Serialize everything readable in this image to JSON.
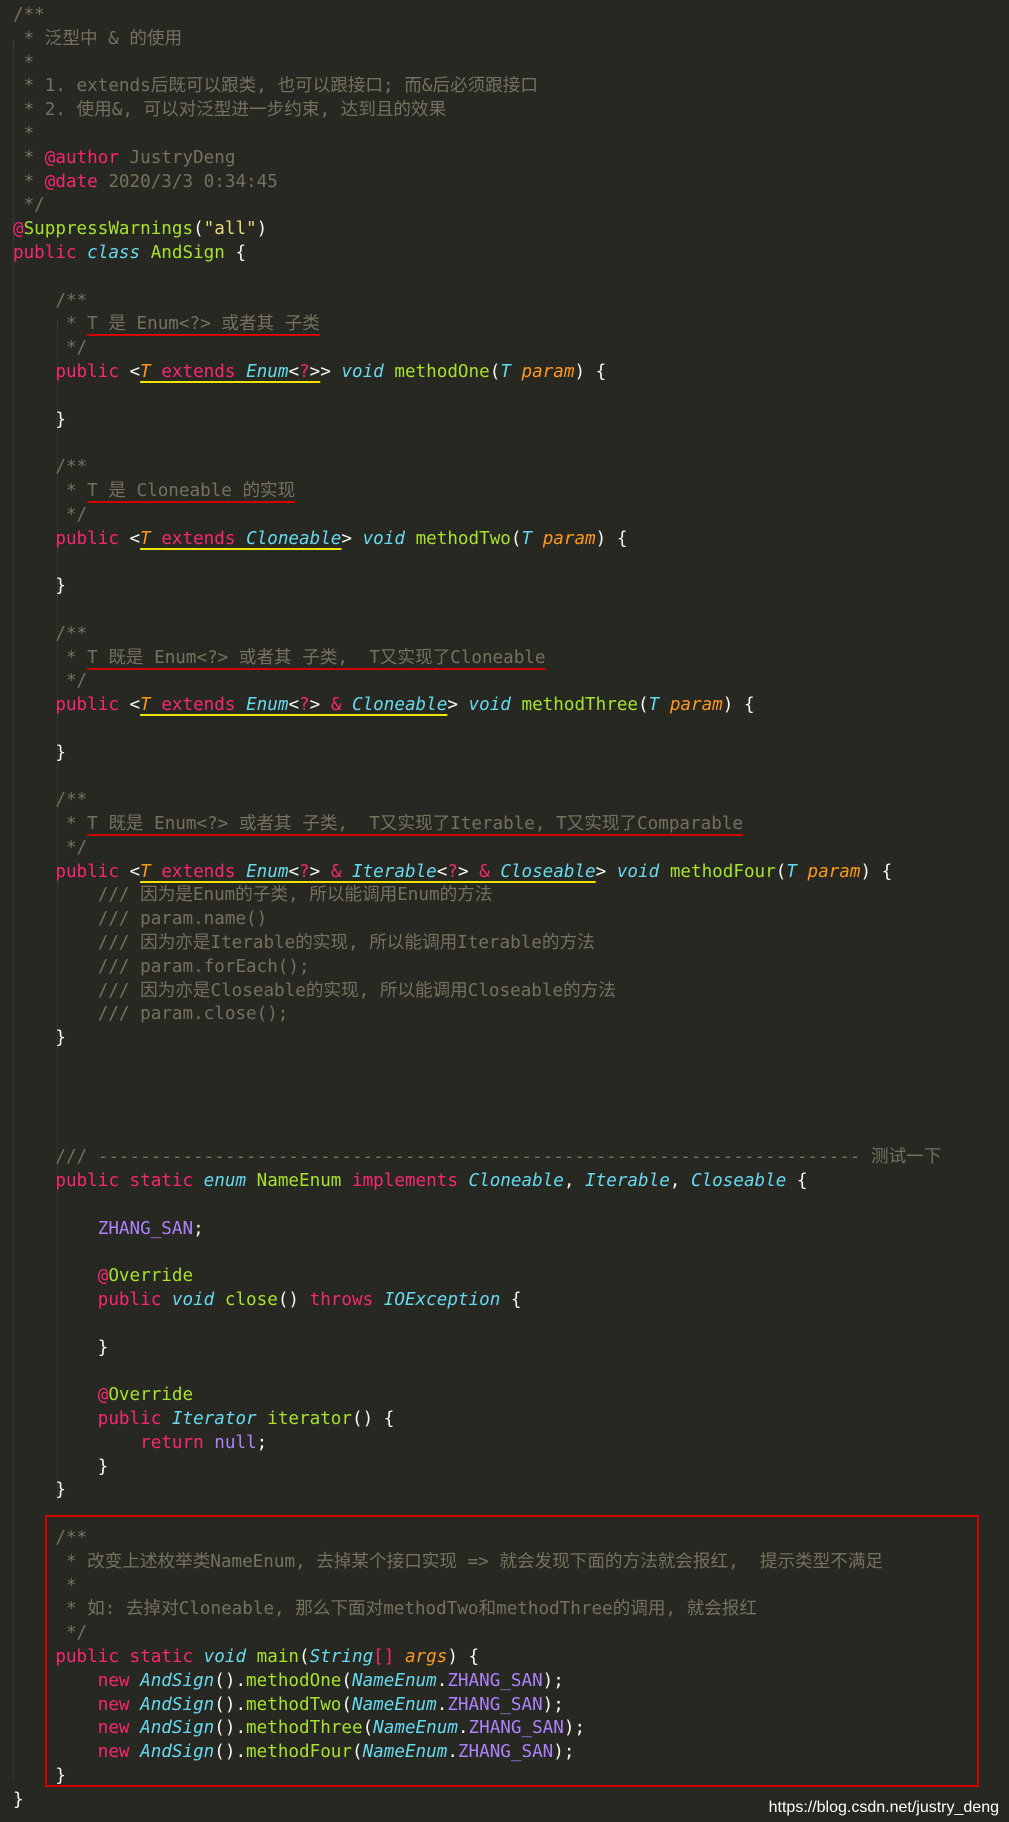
{
  "lines": [
    [
      {
        "c": "c",
        "t": "/**"
      }
    ],
    [
      {
        "c": "c",
        "t": " * 泛型中 & 的使用"
      }
    ],
    [
      {
        "c": "c",
        "t": " *"
      }
    ],
    [
      {
        "c": "c",
        "t": " * 1. extends后既可以跟类, 也可以跟接口; 而&后必须跟接口"
      }
    ],
    [
      {
        "c": "c",
        "t": " * 2. 使用&, 可以对泛型进一步约束, 达到且的效果"
      }
    ],
    [
      {
        "c": "c",
        "t": " *"
      }
    ],
    [
      {
        "c": "c",
        "t": " * "
      },
      {
        "c": "k",
        "t": "@author"
      },
      {
        "c": "c",
        "t": " JustryDeng"
      }
    ],
    [
      {
        "c": "c",
        "t": " * "
      },
      {
        "c": "k",
        "t": "@date"
      },
      {
        "c": "c",
        "t": " 2020/3/3 0:34:45"
      }
    ],
    [
      {
        "c": "c",
        "t": " */"
      }
    ],
    [
      {
        "c": "k",
        "t": "@"
      },
      {
        "c": "f",
        "t": "SuppressWarnings"
      },
      {
        "c": "",
        "t": "("
      },
      {
        "c": "s",
        "t": "\"all\""
      },
      {
        "c": "",
        "t": ")"
      }
    ],
    [
      {
        "c": "k",
        "t": "public "
      },
      {
        "c": "t",
        "t": "class "
      },
      {
        "c": "f",
        "t": "AndSign"
      },
      {
        "c": "",
        "t": " {"
      }
    ],
    [
      {
        "c": "",
        "t": ""
      }
    ],
    [
      {
        "c": "c",
        "t": "    /**"
      }
    ],
    [
      {
        "c": "c",
        "t": "     * "
      },
      {
        "c": "c red-ul",
        "t": "T 是 Enum<?> 或者其 子类"
      }
    ],
    [
      {
        "c": "c",
        "t": "     */"
      }
    ],
    [
      {
        "c": "k",
        "t": "    public "
      },
      {
        "c": "",
        "t": "<"
      },
      {
        "c": "p ul",
        "t": "T "
      },
      {
        "c": "k ul",
        "t": "extends "
      },
      {
        "c": "t ul",
        "t": "Enum"
      },
      {
        "c": "ul",
        "t": "<"
      },
      {
        "c": "k ul",
        "t": "?"
      },
      {
        "c": "ul",
        "t": ">"
      },
      {
        "c": "",
        "t": "> "
      },
      {
        "c": "t",
        "t": "void "
      },
      {
        "c": "f",
        "t": "methodOne"
      },
      {
        "c": "",
        "t": "("
      },
      {
        "c": "t",
        "t": "T "
      },
      {
        "c": "p",
        "t": "param"
      },
      {
        "c": "",
        "t": ") {"
      }
    ],
    [
      {
        "c": "",
        "t": ""
      }
    ],
    [
      {
        "c": "",
        "t": "    }"
      }
    ],
    [
      {
        "c": "",
        "t": ""
      }
    ],
    [
      {
        "c": "c",
        "t": "    /**"
      }
    ],
    [
      {
        "c": "c",
        "t": "     * "
      },
      {
        "c": "c red-ul",
        "t": "T 是 Cloneable 的实现"
      }
    ],
    [
      {
        "c": "c",
        "t": "     */"
      }
    ],
    [
      {
        "c": "k",
        "t": "    public "
      },
      {
        "c": "",
        "t": "<"
      },
      {
        "c": "p ul",
        "t": "T "
      },
      {
        "c": "k ul",
        "t": "extends "
      },
      {
        "c": "t ul",
        "t": "Cloneable"
      },
      {
        "c": "",
        "t": "> "
      },
      {
        "c": "t",
        "t": "void "
      },
      {
        "c": "f",
        "t": "methodTwo"
      },
      {
        "c": "",
        "t": "("
      },
      {
        "c": "t",
        "t": "T "
      },
      {
        "c": "p",
        "t": "param"
      },
      {
        "c": "",
        "t": ") {"
      }
    ],
    [
      {
        "c": "",
        "t": ""
      }
    ],
    [
      {
        "c": "",
        "t": "    }"
      }
    ],
    [
      {
        "c": "",
        "t": ""
      }
    ],
    [
      {
        "c": "c",
        "t": "    /**"
      }
    ],
    [
      {
        "c": "c",
        "t": "     * "
      },
      {
        "c": "c red-ul",
        "t": "T 既是 Enum<?> 或者其 子类,  T又实现了Cloneable"
      }
    ],
    [
      {
        "c": "c",
        "t": "     */"
      }
    ],
    [
      {
        "c": "k",
        "t": "    public "
      },
      {
        "c": "",
        "t": "<"
      },
      {
        "c": "p ul",
        "t": "T "
      },
      {
        "c": "k ul",
        "t": "extends "
      },
      {
        "c": "t ul",
        "t": "Enum"
      },
      {
        "c": "ul",
        "t": "<"
      },
      {
        "c": "k ul",
        "t": "?"
      },
      {
        "c": "ul",
        "t": "> "
      },
      {
        "c": "k ul",
        "t": "& "
      },
      {
        "c": "t ul",
        "t": "Cloneable"
      },
      {
        "c": "",
        "t": "> "
      },
      {
        "c": "t",
        "t": "void "
      },
      {
        "c": "f",
        "t": "methodThree"
      },
      {
        "c": "",
        "t": "("
      },
      {
        "c": "t",
        "t": "T "
      },
      {
        "c": "p",
        "t": "param"
      },
      {
        "c": "",
        "t": ") {"
      }
    ],
    [
      {
        "c": "",
        "t": ""
      }
    ],
    [
      {
        "c": "",
        "t": "    }"
      }
    ],
    [
      {
        "c": "",
        "t": ""
      }
    ],
    [
      {
        "c": "c",
        "t": "    /**"
      }
    ],
    [
      {
        "c": "c",
        "t": "     * "
      },
      {
        "c": "c red-ul",
        "t": "T 既是 Enum<?> 或者其 子类,  T又实现了Iterable, T又实现了Comparable"
      }
    ],
    [
      {
        "c": "c",
        "t": "     */"
      }
    ],
    [
      {
        "c": "k",
        "t": "    public "
      },
      {
        "c": "",
        "t": "<"
      },
      {
        "c": "p ul",
        "t": "T "
      },
      {
        "c": "k ul",
        "t": "extends "
      },
      {
        "c": "t ul",
        "t": "Enum"
      },
      {
        "c": "ul",
        "t": "<"
      },
      {
        "c": "k ul",
        "t": "?"
      },
      {
        "c": "ul",
        "t": "> "
      },
      {
        "c": "k ul",
        "t": "& "
      },
      {
        "c": "t ul",
        "t": "Iterable"
      },
      {
        "c": "ul",
        "t": "<"
      },
      {
        "c": "k ul",
        "t": "?"
      },
      {
        "c": "ul",
        "t": "> "
      },
      {
        "c": "k ul",
        "t": "& "
      },
      {
        "c": "t ul",
        "t": "Closeable"
      },
      {
        "c": "",
        "t": "> "
      },
      {
        "c": "t",
        "t": "void "
      },
      {
        "c": "f",
        "t": "methodFour"
      },
      {
        "c": "",
        "t": "("
      },
      {
        "c": "t",
        "t": "T "
      },
      {
        "c": "p",
        "t": "param"
      },
      {
        "c": "",
        "t": ") {"
      }
    ],
    [
      {
        "c": "c",
        "t": "        /// 因为是Enum的子类, 所以能调用Enum的方法"
      }
    ],
    [
      {
        "c": "c",
        "t": "        /// param.name()"
      }
    ],
    [
      {
        "c": "c",
        "t": "        /// 因为亦是Iterable的实现, 所以能调用Iterable的方法"
      }
    ],
    [
      {
        "c": "c",
        "t": "        /// param.forEach();"
      }
    ],
    [
      {
        "c": "c",
        "t": "        /// 因为亦是Closeable的实现, 所以能调用Closeable的方法"
      }
    ],
    [
      {
        "c": "c",
        "t": "        /// param.close();"
      }
    ],
    [
      {
        "c": "",
        "t": "    }"
      }
    ],
    [
      {
        "c": "",
        "t": ""
      }
    ],
    [
      {
        "c": "",
        "t": ""
      }
    ],
    [
      {
        "c": "",
        "t": ""
      }
    ],
    [
      {
        "c": "",
        "t": ""
      }
    ],
    [
      {
        "c": "c",
        "t": "    /// ------------------------------------------------------------------------ 测试一下"
      }
    ],
    [
      {
        "c": "k",
        "t": "    public static "
      },
      {
        "c": "t",
        "t": "enum "
      },
      {
        "c": "f",
        "t": "NameEnum "
      },
      {
        "c": "k",
        "t": "implements "
      },
      {
        "c": "t",
        "t": "Cloneable"
      },
      {
        "c": "",
        "t": ", "
      },
      {
        "c": "t",
        "t": "Iterable"
      },
      {
        "c": "",
        "t": ", "
      },
      {
        "c": "t",
        "t": "Closeable"
      },
      {
        "c": "",
        "t": " {"
      }
    ],
    [
      {
        "c": "",
        "t": ""
      }
    ],
    [
      {
        "c": "cst",
        "t": "        ZHANG_SAN"
      },
      {
        "c": "",
        "t": ";"
      }
    ],
    [
      {
        "c": "",
        "t": ""
      }
    ],
    [
      {
        "c": "k",
        "t": "        @"
      },
      {
        "c": "f",
        "t": "Override"
      }
    ],
    [
      {
        "c": "k",
        "t": "        public "
      },
      {
        "c": "t",
        "t": "void "
      },
      {
        "c": "f",
        "t": "close"
      },
      {
        "c": "",
        "t": "() "
      },
      {
        "c": "k",
        "t": "throws "
      },
      {
        "c": "t",
        "t": "IOException"
      },
      {
        "c": "",
        "t": " {"
      }
    ],
    [
      {
        "c": "",
        "t": ""
      }
    ],
    [
      {
        "c": "",
        "t": "        }"
      }
    ],
    [
      {
        "c": "",
        "t": ""
      }
    ],
    [
      {
        "c": "k",
        "t": "        @"
      },
      {
        "c": "f",
        "t": "Override"
      }
    ],
    [
      {
        "c": "k",
        "t": "        public "
      },
      {
        "c": "t",
        "t": "Iterator "
      },
      {
        "c": "f",
        "t": "iterator"
      },
      {
        "c": "",
        "t": "() {"
      }
    ],
    [
      {
        "c": "k",
        "t": "            return "
      },
      {
        "c": "cst",
        "t": "null"
      },
      {
        "c": "",
        "t": ";"
      }
    ],
    [
      {
        "c": "",
        "t": "        }"
      }
    ],
    [
      {
        "c": "",
        "t": "    }"
      }
    ],
    [
      {
        "c": "",
        "t": ""
      }
    ],
    [
      {
        "c": "c",
        "t": "    /**"
      }
    ],
    [
      {
        "c": "c",
        "t": "     * 改变上述枚举类NameEnum, 去掉某个接口实现 => 就会发现下面的方法就会报红,  提示类型不满足"
      }
    ],
    [
      {
        "c": "c",
        "t": "     *"
      }
    ],
    [
      {
        "c": "c",
        "t": "     * 如: 去掉对Cloneable, 那么下面对methodTwo和methodThree的调用, 就会报红"
      }
    ],
    [
      {
        "c": "c",
        "t": "     */"
      }
    ],
    [
      {
        "c": "k",
        "t": "    public static "
      },
      {
        "c": "t",
        "t": "void "
      },
      {
        "c": "f",
        "t": "main"
      },
      {
        "c": "",
        "t": "("
      },
      {
        "c": "t",
        "t": "String"
      },
      {
        "c": "k",
        "t": "[] "
      },
      {
        "c": "p",
        "t": "args"
      },
      {
        "c": "",
        "t": ") {"
      }
    ],
    [
      {
        "c": "k",
        "t": "        new "
      },
      {
        "c": "t",
        "t": "AndSign"
      },
      {
        "c": "",
        "t": "()."
      },
      {
        "c": "f",
        "t": "methodOne"
      },
      {
        "c": "",
        "t": "("
      },
      {
        "c": "t",
        "t": "NameEnum"
      },
      {
        "c": "",
        "t": "."
      },
      {
        "c": "cst",
        "t": "ZHANG_SAN"
      },
      {
        "c": "",
        "t": ");"
      }
    ],
    [
      {
        "c": "k",
        "t": "        new "
      },
      {
        "c": "t",
        "t": "AndSign"
      },
      {
        "c": "",
        "t": "()."
      },
      {
        "c": "f",
        "t": "methodTwo"
      },
      {
        "c": "",
        "t": "("
      },
      {
        "c": "t",
        "t": "NameEnum"
      },
      {
        "c": "",
        "t": "."
      },
      {
        "c": "cst",
        "t": "ZHANG_SAN"
      },
      {
        "c": "",
        "t": ");"
      }
    ],
    [
      {
        "c": "k",
        "t": "        new "
      },
      {
        "c": "t",
        "t": "AndSign"
      },
      {
        "c": "",
        "t": "()."
      },
      {
        "c": "f",
        "t": "methodThree"
      },
      {
        "c": "",
        "t": "("
      },
      {
        "c": "t",
        "t": "NameEnum"
      },
      {
        "c": "",
        "t": "."
      },
      {
        "c": "cst",
        "t": "ZHANG_SAN"
      },
      {
        "c": "",
        "t": ");"
      }
    ],
    [
      {
        "c": "k",
        "t": "        new "
      },
      {
        "c": "t",
        "t": "AndSign"
      },
      {
        "c": "",
        "t": "()."
      },
      {
        "c": "f",
        "t": "methodFour"
      },
      {
        "c": "",
        "t": "("
      },
      {
        "c": "t",
        "t": "NameEnum"
      },
      {
        "c": "",
        "t": "."
      },
      {
        "c": "cst",
        "t": "ZHANG_SAN"
      },
      {
        "c": "",
        "t": ");"
      }
    ],
    [
      {
        "c": "",
        "t": "    }"
      }
    ],
    [
      {
        "c": "",
        "t": "}"
      }
    ]
  ],
  "watermark": "https://blog.csdn.net/justry_deng",
  "colors": {
    "background": "#272822",
    "default": "#f8f8f2",
    "comment": "#75715e",
    "keyword": "#f92672",
    "string": "#e6db74",
    "type": "#66d9ef",
    "function": "#a6e22e",
    "param": "#fd971f",
    "constant": "#ae81ff",
    "highlight_yellow": "#f2e600",
    "highlight_red": "#d40000"
  }
}
